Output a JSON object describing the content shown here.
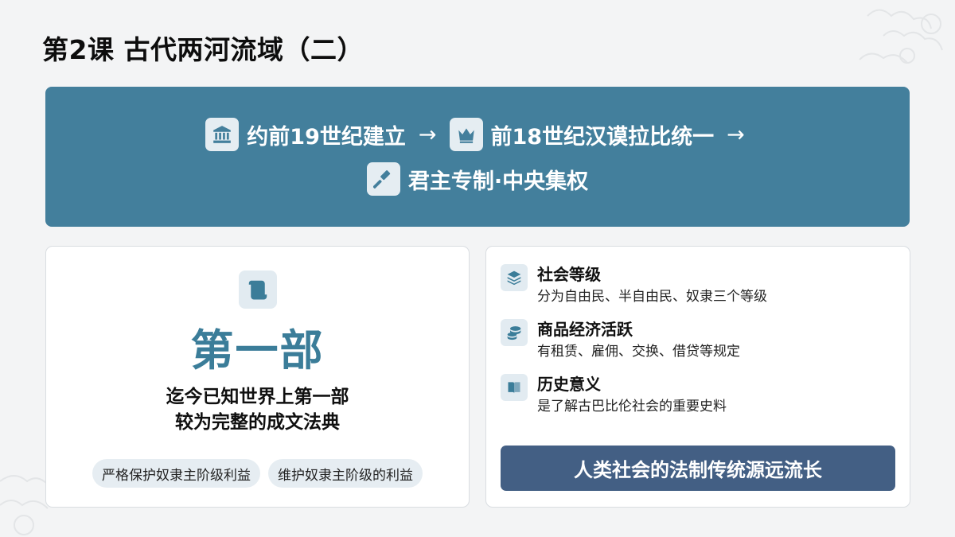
{
  "title": "第2课 古代两河流域（二）",
  "timeline": {
    "step1": "约前19世纪建立",
    "step2": "前18世纪汉谟拉比统一",
    "step3": "君主专制·中央集权",
    "arrow": "→",
    "icons": [
      "museum-icon",
      "crown-icon",
      "gavel-icon"
    ]
  },
  "code_card": {
    "icon": "scroll-icon",
    "headline": "第一部",
    "desc_line1": "迄今已知世界上第一部",
    "desc_line2": "较为完整的成文法典",
    "tags": [
      "严格保护奴隶主阶级利益",
      "维护奴隶主阶级的利益"
    ]
  },
  "features": [
    {
      "icon": "layers-icon",
      "title": "社会等级",
      "desc": "分为自由民、半自由民、奴隶三个等级"
    },
    {
      "icon": "coins-icon",
      "title": "商品经济活跃",
      "desc": "有租赁、雇佣、交换、借贷等规定"
    },
    {
      "icon": "book-icon",
      "title": "历史意义",
      "desc": "是了解古巴比伦社会的重要史料"
    }
  ],
  "banner": "人类社会的法制传统源远流长",
  "colors": {
    "accent": "#437f9c",
    "headline": "#3b7d99",
    "banner": "#435f84",
    "icon_bg": "#e2ebf1"
  }
}
